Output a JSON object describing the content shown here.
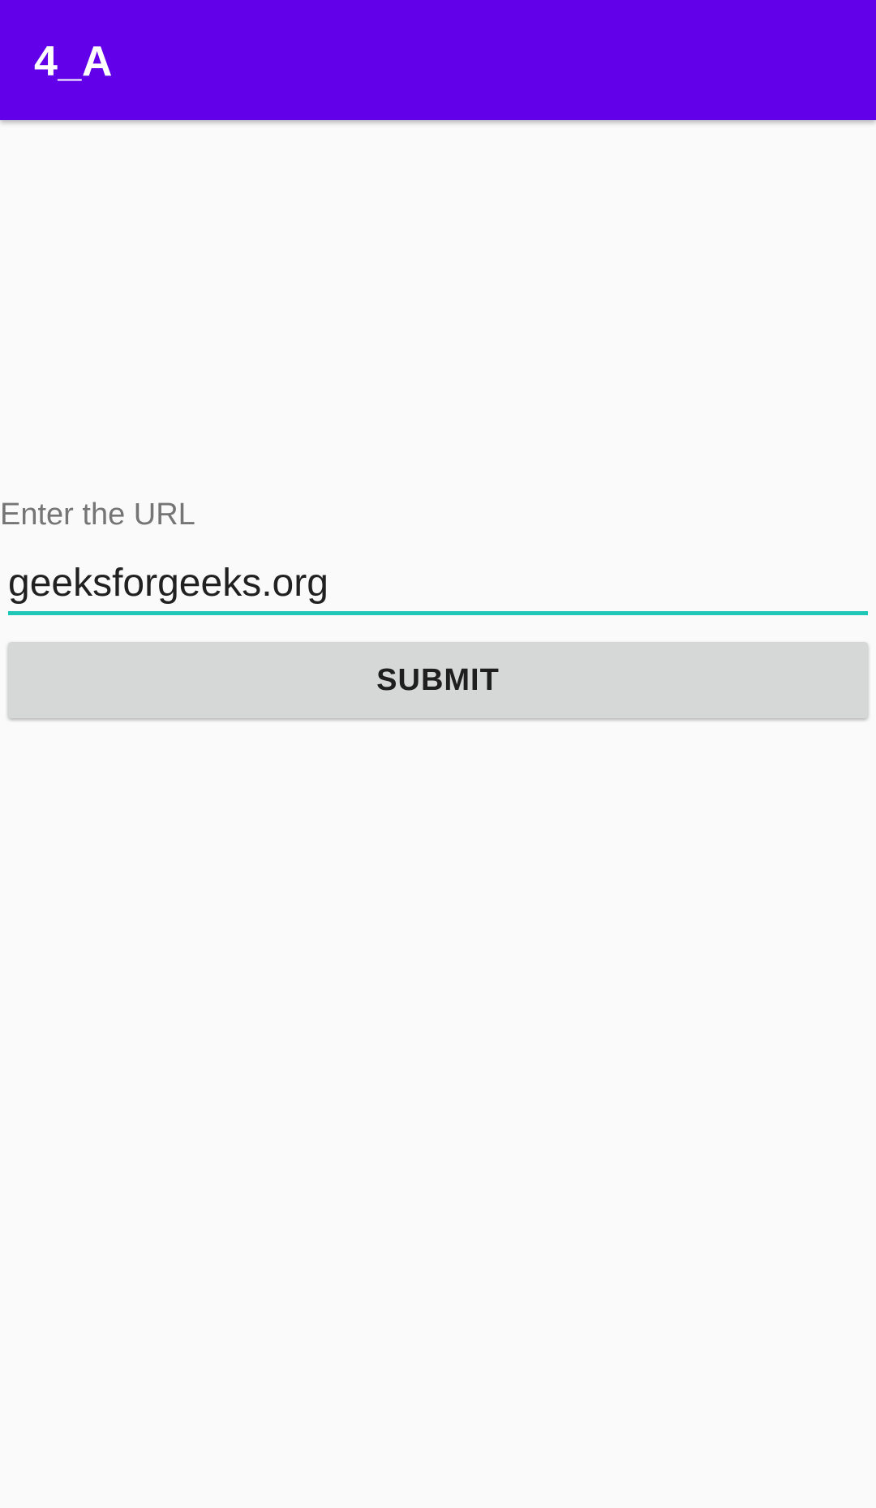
{
  "app_bar": {
    "title": "4_A",
    "color": "#6200ea"
  },
  "form": {
    "label": "Enter the URL",
    "url_input": {
      "value": "geeksforgeeks.org",
      "underline_color": "#1fc7b6"
    },
    "submit_label": "SUBMIT"
  }
}
